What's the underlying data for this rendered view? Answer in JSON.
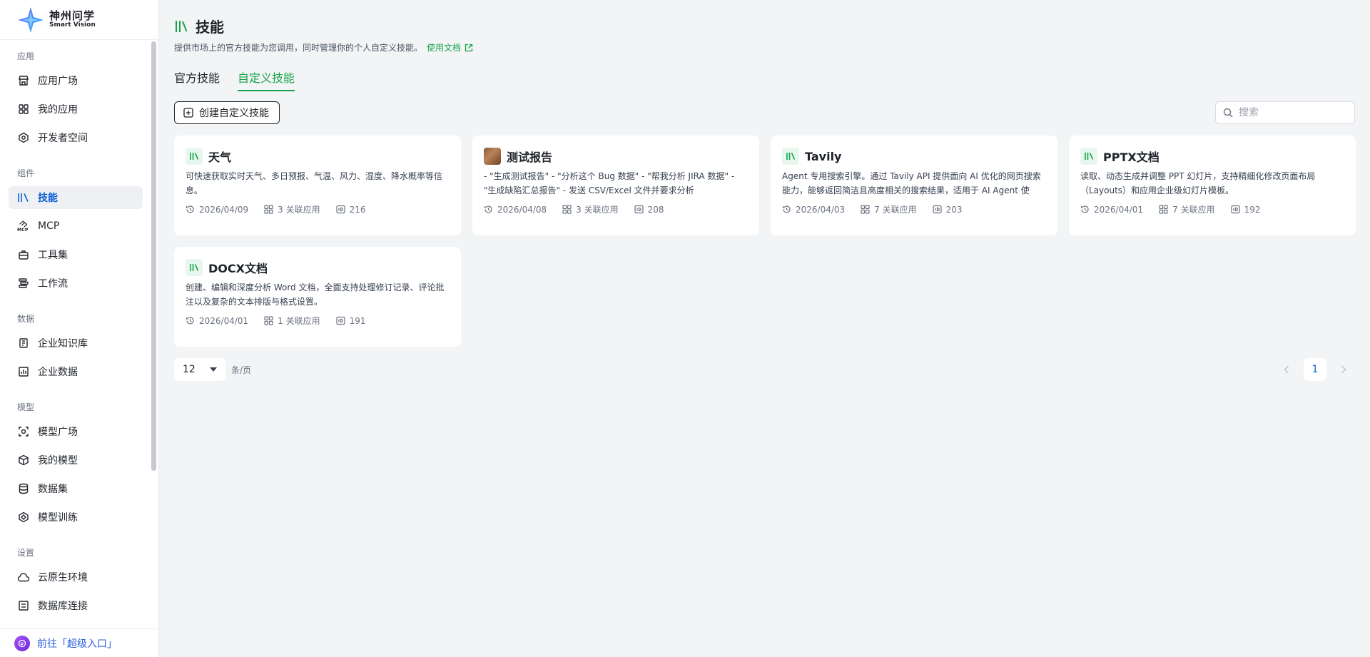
{
  "app": {
    "name_cn": "神州问学",
    "name_en": "Smart Vision"
  },
  "sidebar": {
    "groups": [
      {
        "title": "应用",
        "items": [
          {
            "label": "应用广场",
            "icon": "store-icon"
          },
          {
            "label": "我的应用",
            "icon": "apps-grid-icon"
          },
          {
            "label": "开发者空间",
            "icon": "developer-space-icon"
          }
        ]
      },
      {
        "title": "组件",
        "items": [
          {
            "label": "技能",
            "icon": "library-icon",
            "active": true
          },
          {
            "label": "MCP",
            "icon": "mcp-icon"
          },
          {
            "label": "工具集",
            "icon": "toolbox-icon"
          },
          {
            "label": "工作流",
            "icon": "workflow-icon"
          }
        ]
      },
      {
        "title": "数据",
        "items": [
          {
            "label": "企业知识库",
            "icon": "knowledge-base-icon"
          },
          {
            "label": "企业数据",
            "icon": "data-chart-icon"
          }
        ]
      },
      {
        "title": "模型",
        "items": [
          {
            "label": "模型广场",
            "icon": "model-square-icon"
          },
          {
            "label": "我的模型",
            "icon": "cube-icon"
          },
          {
            "label": "数据集",
            "icon": "database-icon"
          },
          {
            "label": "模型训练",
            "icon": "training-icon"
          }
        ]
      },
      {
        "title": "设置",
        "items": [
          {
            "label": "云原生环境",
            "icon": "cloud-icon"
          },
          {
            "label": "数据库连接",
            "icon": "db-connect-icon"
          }
        ]
      }
    ],
    "super_entry": "前往「超级入口」"
  },
  "page": {
    "title": "技能",
    "description": "提供市场上的官方技能为您调用，同时管理你的个人自定义技能。",
    "doc_link": "使用文档",
    "tabs": [
      {
        "label": "官方技能",
        "active": false
      },
      {
        "label": "自定义技能",
        "active": true
      }
    ],
    "create_button": "创建自定义技能",
    "search_placeholder": "搜索"
  },
  "cards": [
    {
      "title": "天气",
      "icon": "skill-book-icon",
      "description": "可快速获取实时天气、多日预报、气温、风力、湿度、降水概率等信息。",
      "date": "2026/04/09",
      "linked_apps": "3 关联应用",
      "id": "216"
    },
    {
      "title": "测试报告",
      "icon": "photo-thumbnail-icon",
      "description": "- \"生成测试报告\" - \"分析这个 Bug 数据\" - \"帮我分析 JIRA 数据\" - \"生成缺陷汇总报告\" - 发送 CSV/Excel 文件并要求分析",
      "date": "2026/04/08",
      "linked_apps": "3 关联应用",
      "id": "208"
    },
    {
      "title": "Tavily",
      "icon": "skill-book-icon",
      "description": "Agent 专用搜索引擎。通过 Tavily API 提供面向 AI 优化的网页搜索能力，能够返回简洁且高度相关的搜索结果，适用于 AI Agent 使用。",
      "date": "2026/04/03",
      "linked_apps": "7 关联应用",
      "id": "203"
    },
    {
      "title": "PPTX文档",
      "icon": "skill-book-icon",
      "description": "读取、动态生成并调整 PPT 幻灯片，支持精细化修改页面布局（Layouts）和应用企业级幻灯片模板。",
      "date": "2026/04/01",
      "linked_apps": "7 关联应用",
      "id": "192"
    },
    {
      "title": "DOCX文档",
      "icon": "skill-book-icon",
      "description": "创建、编辑和深度分析 Word 文档，全面支持处理修订记录、评论批注以及复杂的文本排版与格式设置。",
      "date": "2026/04/01",
      "linked_apps": "1 关联应用",
      "id": "191"
    }
  ],
  "pagination": {
    "page_size": "12",
    "unit": "条/页",
    "current_page": "1"
  },
  "colors": {
    "accent_green": "#16a34a",
    "active_blue": "#0b5fd6",
    "background": "#f3f4f6"
  }
}
